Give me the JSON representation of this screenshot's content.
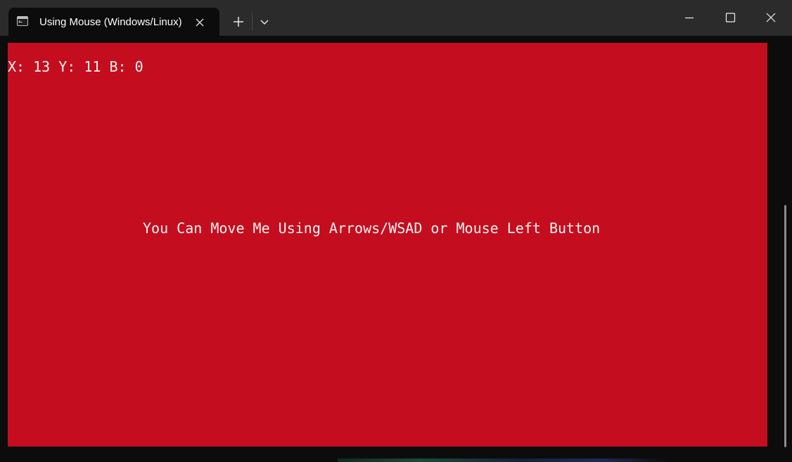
{
  "window": {
    "tab_title": "Using Mouse (Windows/Linux)",
    "icons": {
      "tab_icon": "terminal-icon",
      "tab_close": "close-icon",
      "new_tab": "plus-icon",
      "dropdown": "chevron-down-icon",
      "minimize": "minimize-icon",
      "maximize": "maximize-icon",
      "close": "close-icon"
    }
  },
  "console": {
    "status_line": "X: 13 Y: 11 B: 0",
    "message": "You Can Move Me Using Arrows/WSAD or Mouse Left Button",
    "background_color": "#c40e1f",
    "text_color": "#f2f2f2"
  }
}
